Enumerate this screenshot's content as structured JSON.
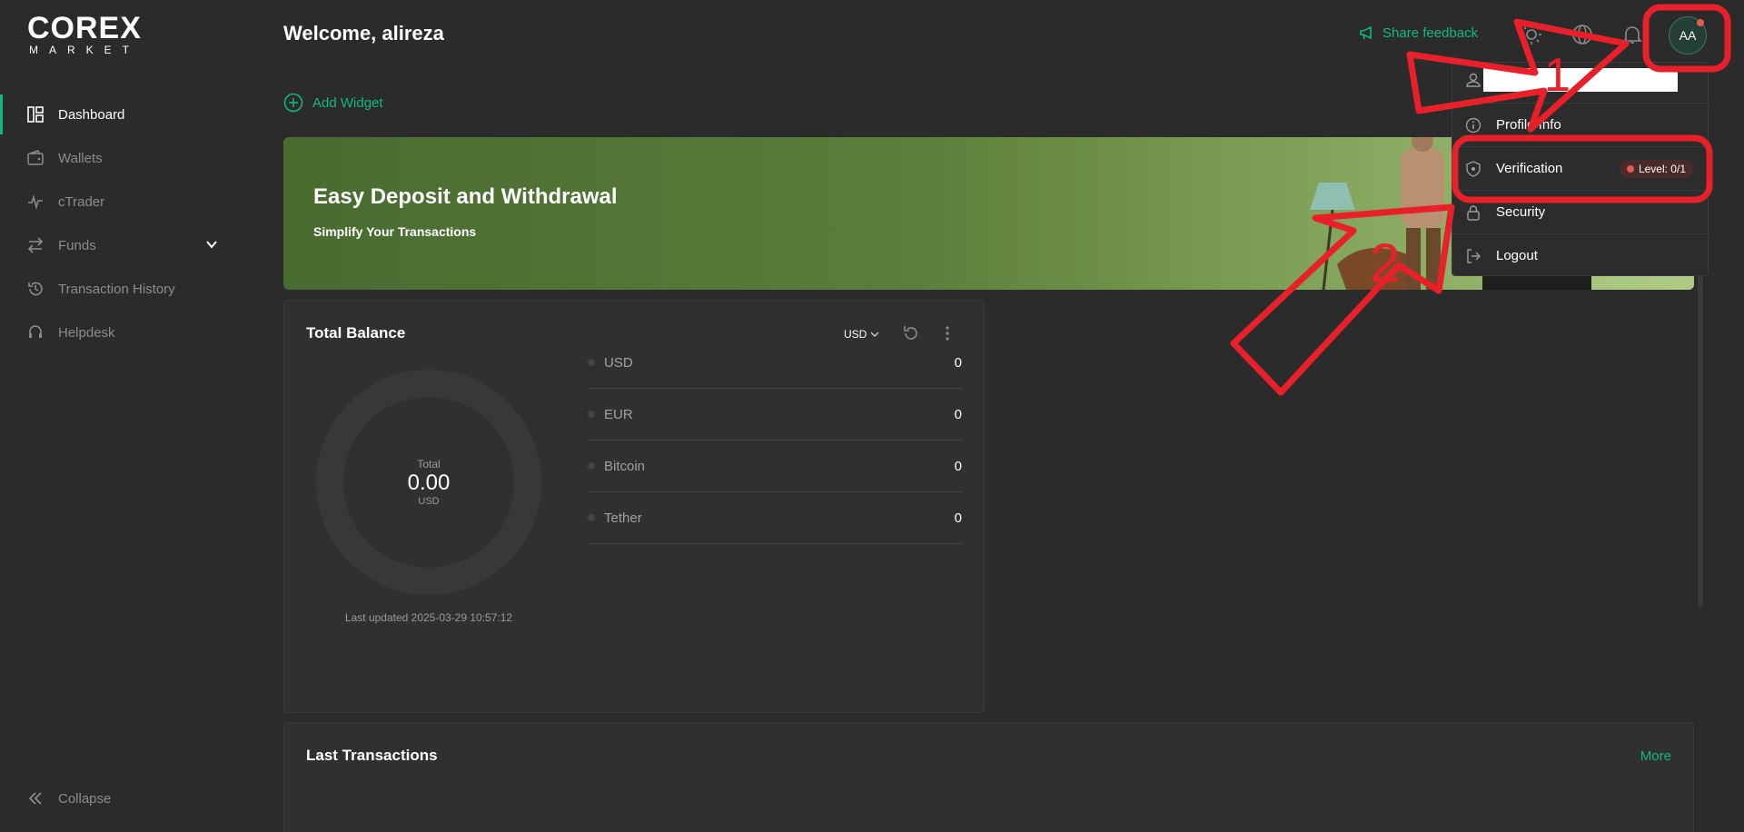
{
  "sidebar": {
    "logo_top": "COREX",
    "logo_bottom": "MARKET",
    "items": [
      {
        "label": "Dashboard",
        "icon": "dashboard-icon"
      },
      {
        "label": "Wallets",
        "icon": "wallet-icon"
      },
      {
        "label": "cTrader",
        "icon": "ctrader-icon"
      },
      {
        "label": "Funds",
        "icon": "transfer-icon"
      },
      {
        "label": "Transaction History",
        "icon": "history-icon"
      },
      {
        "label": "Helpdesk",
        "icon": "headset-icon"
      }
    ],
    "collapse_label": "Collapse"
  },
  "header": {
    "welcome": "Welcome, alireza",
    "feedback_label": "Share feedback",
    "avatar_initials": "AA"
  },
  "add_widget_label": "Add Widget",
  "banner": {
    "title": "Easy Deposit and Withdrawal",
    "subtitle": "Simplify Your Transactions"
  },
  "balance": {
    "title": "Total Balance",
    "currency": "USD",
    "total_label": "Total",
    "total_value": "0.00",
    "total_unit": "USD",
    "updated": "Last updated 2025-03-29 10:57:12",
    "rows": [
      {
        "name": "USD",
        "value": "0"
      },
      {
        "name": "EUR",
        "value": "0"
      },
      {
        "name": "Bitcoin",
        "value": "0"
      },
      {
        "name": "Tether",
        "value": "0"
      }
    ]
  },
  "last_transactions": {
    "title": "Last Transactions",
    "more_label": "More"
  },
  "profile_menu": {
    "items": [
      {
        "label": "Profile Info",
        "icon": "info-icon"
      },
      {
        "label": "Verification",
        "icon": "shield-icon",
        "badge": "Level: 0/1"
      },
      {
        "label": "Security",
        "icon": "lock-icon"
      },
      {
        "label": "Logout",
        "icon": "logout-icon"
      }
    ]
  },
  "annotations": [
    "1",
    "2"
  ],
  "colors": {
    "accent": "#10b981",
    "annotation": "#e8202a",
    "background": "#2b2b2b"
  }
}
